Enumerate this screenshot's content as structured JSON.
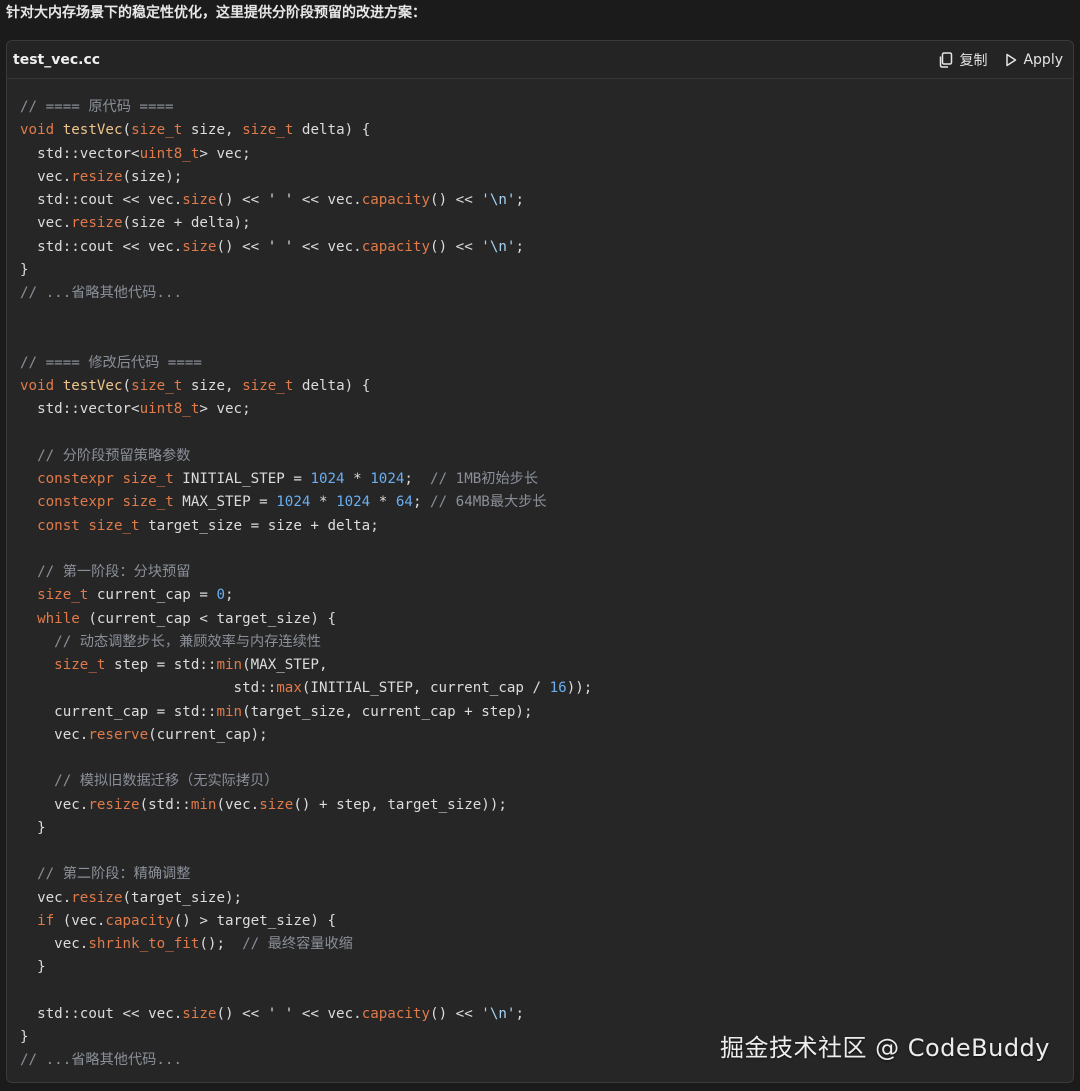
{
  "intro_text": "针对大内存场景下的稳定性优化，这里提供分阶段预留的改进方案：",
  "code_block": {
    "file_name": "test_vec.cc",
    "copy_label": "复制",
    "apply_label": "Apply",
    "lines": [
      [
        [
          "comment",
          "// ==== 原代码 ===="
        ]
      ],
      [
        [
          "keyword",
          "void"
        ],
        [
          "plain",
          " "
        ],
        [
          "fname",
          "testVec"
        ],
        [
          "plain",
          "("
        ],
        [
          "type",
          "size_t"
        ],
        [
          "plain",
          " size, "
        ],
        [
          "type",
          "size_t"
        ],
        [
          "plain",
          " delta) {"
        ]
      ],
      [
        [
          "plain",
          "  std::vector<"
        ],
        [
          "type",
          "uint8_t"
        ],
        [
          "plain",
          "> vec;"
        ]
      ],
      [
        [
          "plain",
          "  vec."
        ],
        [
          "func",
          "resize"
        ],
        [
          "plain",
          "(size);"
        ]
      ],
      [
        [
          "plain",
          "  std::cout << vec."
        ],
        [
          "func",
          "size"
        ],
        [
          "plain",
          "() << ' ' << vec."
        ],
        [
          "func",
          "capacity"
        ],
        [
          "plain",
          "() << "
        ],
        [
          "string",
          "'\\n'"
        ],
        [
          "plain",
          ";"
        ]
      ],
      [
        [
          "plain",
          "  vec."
        ],
        [
          "func",
          "resize"
        ],
        [
          "plain",
          "(size + delta);"
        ]
      ],
      [
        [
          "plain",
          "  std::cout << vec."
        ],
        [
          "func",
          "size"
        ],
        [
          "plain",
          "() << ' ' << vec."
        ],
        [
          "func",
          "capacity"
        ],
        [
          "plain",
          "() << "
        ],
        [
          "string",
          "'\\n'"
        ],
        [
          "plain",
          ";"
        ]
      ],
      [
        [
          "plain",
          "}"
        ]
      ],
      [
        [
          "comment",
          "// ...省略其他代码..."
        ]
      ],
      [],
      [],
      [
        [
          "comment",
          "// ==== 修改后代码 ===="
        ]
      ],
      [
        [
          "keyword",
          "void"
        ],
        [
          "plain",
          " "
        ],
        [
          "fname",
          "testVec"
        ],
        [
          "plain",
          "("
        ],
        [
          "type",
          "size_t"
        ],
        [
          "plain",
          " size, "
        ],
        [
          "type",
          "size_t"
        ],
        [
          "plain",
          " delta) {"
        ]
      ],
      [
        [
          "plain",
          "  std::vector<"
        ],
        [
          "type",
          "uint8_t"
        ],
        [
          "plain",
          "> vec;"
        ]
      ],
      [],
      [
        [
          "comment",
          "  // 分阶段预留策略参数"
        ]
      ],
      [
        [
          "keyword",
          "  constexpr"
        ],
        [
          "plain",
          " "
        ],
        [
          "type",
          "size_t"
        ],
        [
          "plain",
          " INITIAL_STEP = "
        ],
        [
          "number",
          "1024"
        ],
        [
          "plain",
          " * "
        ],
        [
          "number",
          "1024"
        ],
        [
          "plain",
          ";  "
        ],
        [
          "comment",
          "// 1MB初始步长"
        ]
      ],
      [
        [
          "keyword",
          "  constexpr"
        ],
        [
          "plain",
          " "
        ],
        [
          "type",
          "size_t"
        ],
        [
          "plain",
          " MAX_STEP = "
        ],
        [
          "number",
          "1024"
        ],
        [
          "plain",
          " * "
        ],
        [
          "number",
          "1024"
        ],
        [
          "plain",
          " * "
        ],
        [
          "number",
          "64"
        ],
        [
          "plain",
          "; "
        ],
        [
          "comment",
          "// 64MB最大步长"
        ]
      ],
      [
        [
          "keyword",
          "  const"
        ],
        [
          "plain",
          " "
        ],
        [
          "type",
          "size_t"
        ],
        [
          "plain",
          " target_size = size + delta;"
        ]
      ],
      [],
      [
        [
          "comment",
          "  // 第一阶段：分块预留"
        ]
      ],
      [
        [
          "type",
          "  size_t"
        ],
        [
          "plain",
          " current_cap = "
        ],
        [
          "number",
          "0"
        ],
        [
          "plain",
          ";"
        ]
      ],
      [
        [
          "keyword",
          "  while"
        ],
        [
          "plain",
          " (current_cap < target_size) {"
        ]
      ],
      [
        [
          "comment",
          "    // 动态调整步长，兼顾效率与内存连续性"
        ]
      ],
      [
        [
          "type",
          "    size_t"
        ],
        [
          "plain",
          " step = std::"
        ],
        [
          "func",
          "min"
        ],
        [
          "plain",
          "(MAX_STEP,"
        ]
      ],
      [
        [
          "plain",
          "                         std::"
        ],
        [
          "func",
          "max"
        ],
        [
          "plain",
          "(INITIAL_STEP, current_cap / "
        ],
        [
          "number",
          "16"
        ],
        [
          "plain",
          "));"
        ]
      ],
      [
        [
          "plain",
          "    current_cap = std::"
        ],
        [
          "func",
          "min"
        ],
        [
          "plain",
          "(target_size, current_cap + step);"
        ]
      ],
      [
        [
          "plain",
          "    vec."
        ],
        [
          "func",
          "reserve"
        ],
        [
          "plain",
          "(current_cap);"
        ]
      ],
      [],
      [
        [
          "comment",
          "    // 模拟旧数据迁移（无实际拷贝）"
        ]
      ],
      [
        [
          "plain",
          "    vec."
        ],
        [
          "func",
          "resize"
        ],
        [
          "plain",
          "(std::"
        ],
        [
          "func",
          "min"
        ],
        [
          "plain",
          "(vec."
        ],
        [
          "func",
          "size"
        ],
        [
          "plain",
          "() + step, target_size));"
        ]
      ],
      [
        [
          "plain",
          "  }"
        ]
      ],
      [],
      [
        [
          "comment",
          "  // 第二阶段：精确调整"
        ]
      ],
      [
        [
          "plain",
          "  vec."
        ],
        [
          "func",
          "resize"
        ],
        [
          "plain",
          "(target_size);"
        ]
      ],
      [
        [
          "keyword",
          "  if"
        ],
        [
          "plain",
          " (vec."
        ],
        [
          "func",
          "capacity"
        ],
        [
          "plain",
          "() > target_size) {"
        ]
      ],
      [
        [
          "plain",
          "    vec."
        ],
        [
          "func",
          "shrink_to_fit"
        ],
        [
          "plain",
          "();  "
        ],
        [
          "comment",
          "// 最终容量收缩"
        ]
      ],
      [
        [
          "plain",
          "  }"
        ]
      ],
      [],
      [
        [
          "plain",
          "  std::cout << vec."
        ],
        [
          "func",
          "size"
        ],
        [
          "plain",
          "() << ' ' << vec."
        ],
        [
          "func",
          "capacity"
        ],
        [
          "plain",
          "() << "
        ],
        [
          "string",
          "'\\n'"
        ],
        [
          "plain",
          ";"
        ]
      ],
      [
        [
          "plain",
          "}"
        ]
      ],
      [
        [
          "comment",
          "// ...省略其他代码..."
        ]
      ]
    ]
  },
  "watermark": "掘金技术社区 @ CodeBuddy",
  "icons": {
    "copy": "copy-icon",
    "apply": "play-icon"
  },
  "colors": {
    "background": "#1b1b1b",
    "panel": "#262626",
    "keyword": "#e07a4a",
    "function_name": "#f0c38a",
    "number": "#6aaef0",
    "string": "#a7d3f2",
    "comment": "#8a8f98",
    "text": "#dcdcdc"
  }
}
